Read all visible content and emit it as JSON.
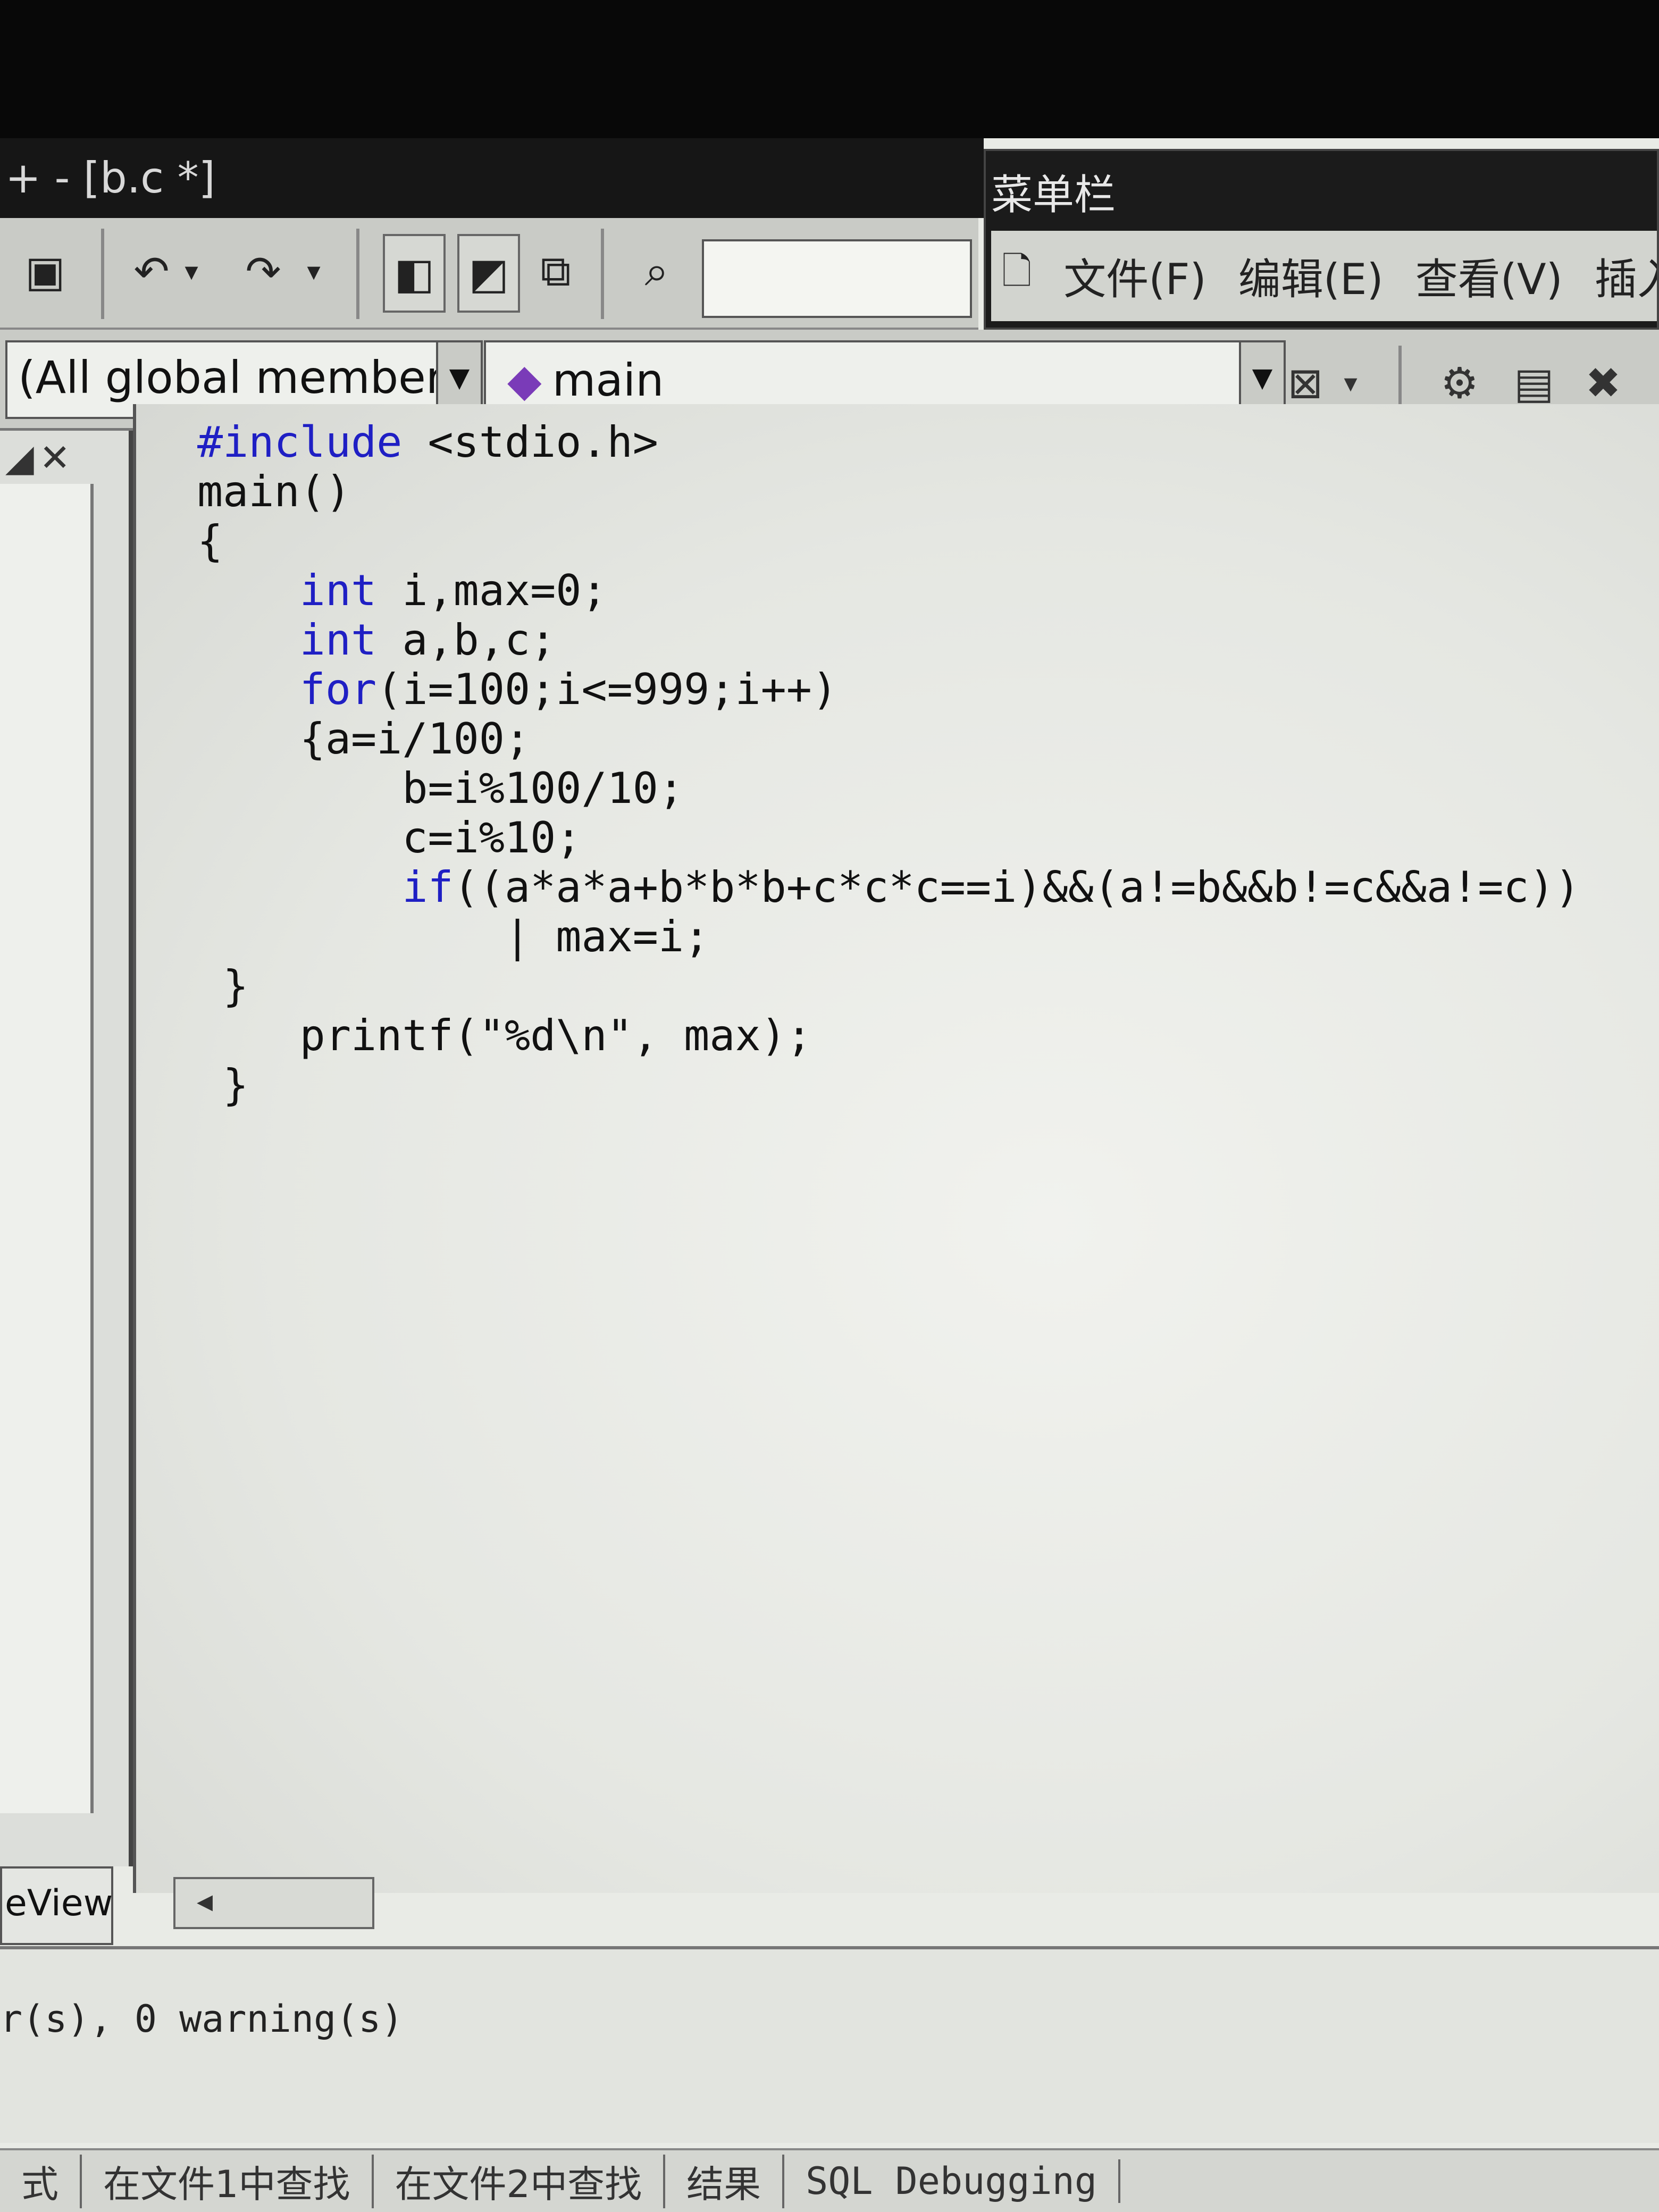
{
  "window": {
    "title": "+ - [b.c *]"
  },
  "toolbar": {
    "icons": [
      "paste-icon",
      "undo-icon",
      "redo-icon",
      "workspace-icon",
      "output-icon",
      "window-list-icon",
      "find-in-files-icon"
    ],
    "find_value": ""
  },
  "menu_panel": {
    "title": "菜单栏",
    "items": [
      "文件(F)",
      "编辑(E)",
      "查看(V)",
      "插入(I)"
    ]
  },
  "wizard_bar": {
    "scope_value": "(All global members",
    "member_value": "main"
  },
  "workspace": {
    "tab_label": "eView"
  },
  "editor": {
    "lines": [
      {
        "kw": "#include",
        "rest": " <stdio.h>"
      },
      {
        "kw": "",
        "rest": "main()"
      },
      {
        "kw": "",
        "rest": "{"
      },
      {
        "kw": "    int",
        "rest": " i,max=0;"
      },
      {
        "kw": "    int",
        "rest": " a,b,c;"
      },
      {
        "kw": "    for",
        "rest": "(i=100;i<=999;i++)"
      },
      {
        "kw": "",
        "rest": "    {a=i/100;"
      },
      {
        "kw": "",
        "rest": "        b=i%100/10;"
      },
      {
        "kw": "",
        "rest": "        c=i%10;"
      },
      {
        "kw": "        if",
        "rest": "((a*a*a+b*b*b+c*c*c==i)&&(a!=b&&b!=c&&a!=c))"
      },
      {
        "kw": "",
        "rest": "            | max=i;"
      },
      {
        "kw": "",
        "rest": " }"
      },
      {
        "kw": "",
        "rest": "    printf(\"%d\\n\", max);"
      },
      {
        "kw": "",
        "rest": " }"
      }
    ]
  },
  "output": {
    "text": "r(s), 0 warning(s)",
    "tabs": [
      "式",
      "在文件1中查找",
      "在文件2中查找",
      "结果",
      "SQL Debugging"
    ]
  }
}
